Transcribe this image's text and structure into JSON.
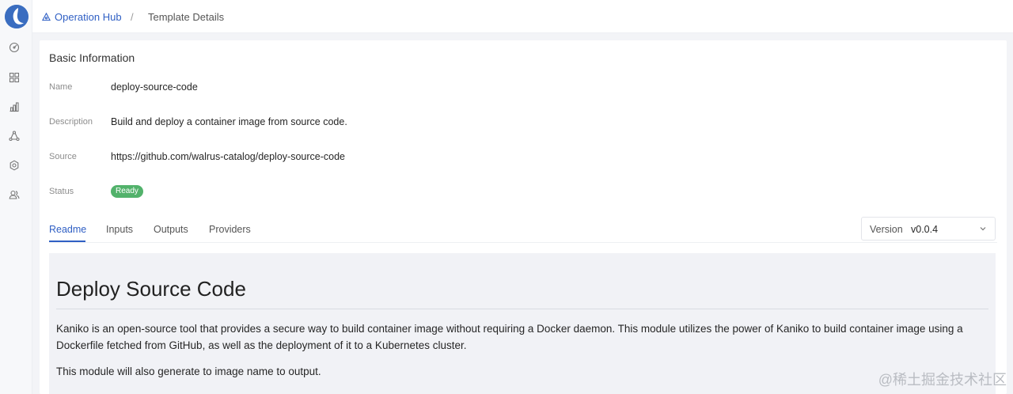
{
  "breadcrumb": {
    "home_label": "Operation Hub",
    "separator": "/",
    "current": "Template Details"
  },
  "sidebar": {
    "icons": [
      "dashboard-icon",
      "applications-icon",
      "chart-icon",
      "operation-icon",
      "settings-icon",
      "users-icon"
    ]
  },
  "basic_info": {
    "title": "Basic Information",
    "name_label": "Name",
    "name_value": "deploy-source-code",
    "description_label": "Description",
    "description_value": "Build and deploy a container image from source code.",
    "source_label": "Source",
    "source_value": "https://github.com/walrus-catalog/deploy-source-code",
    "status_label": "Status",
    "status_value": "Ready"
  },
  "tabs": [
    {
      "label": "Readme",
      "active": true
    },
    {
      "label": "Inputs",
      "active": false
    },
    {
      "label": "Outputs",
      "active": false
    },
    {
      "label": "Providers",
      "active": false
    }
  ],
  "version": {
    "label": "Version",
    "value": "v0.0.4"
  },
  "readme": {
    "heading": "Deploy Source Code",
    "paragraph1_line1": "Kaniko is an open-source tool that provides a secure way to build container image without requiring a Docker daemon. This module utilizes the power of Kaniko to build container image using a",
    "paragraph1_line2": "Dockerfile fetched from GitHub, as well as the deployment of it to a Kubernetes cluster.",
    "paragraph2": "This module will also generate to image name to output."
  },
  "watermark": "@稀土掘金技术社区",
  "colors": {
    "accent": "#2f5fc4",
    "status_ready": "#52b26b",
    "readme_bg": "#f1f2f6"
  }
}
